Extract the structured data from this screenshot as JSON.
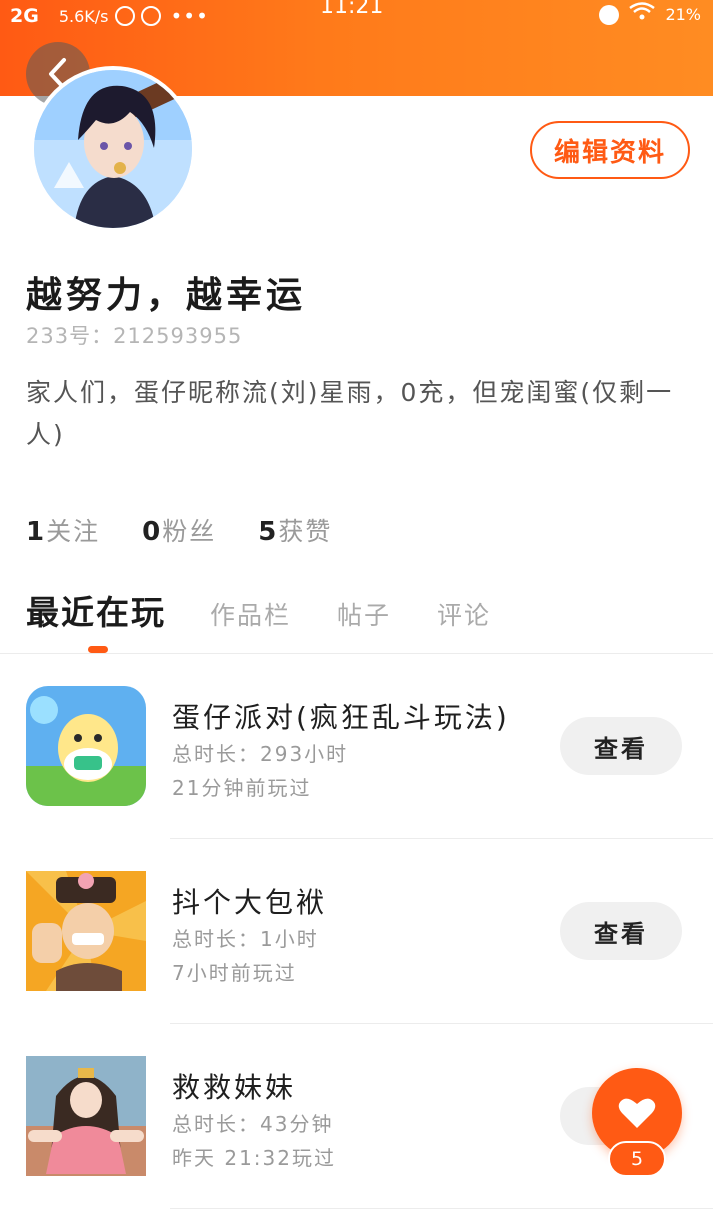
{
  "status_bar": {
    "network": "2G",
    "speed": "5.6K/s",
    "dots": "•••",
    "time": "11:21",
    "battery": "21%"
  },
  "profile": {
    "nickname": "越努力，越幸运",
    "uid": "233号：212593955",
    "bio": "家人们，蛋仔昵称流(刘)星雨，0充，但宠闺蜜(仅剩一人)",
    "edit_label": "编辑资料"
  },
  "stats": [
    {
      "num": "1",
      "label": "关注"
    },
    {
      "num": "0",
      "label": "粉丝"
    },
    {
      "num": "5",
      "label": "获赞"
    }
  ],
  "tabs": [
    {
      "label": "最近在玩",
      "active": true
    },
    {
      "label": "作品栏",
      "active": false
    },
    {
      "label": "帖子",
      "active": false
    },
    {
      "label": "评论",
      "active": false
    }
  ],
  "games": [
    {
      "title": "蛋仔派对(疯狂乱斗玩法)",
      "duration": "总时长：293小时",
      "last_played": "21分钟前玩过",
      "button": "查看",
      "icon": "eggy-party-icon"
    },
    {
      "title": "抖个大包袱",
      "duration": "总时长：1小时",
      "last_played": "7小时前玩过",
      "button": "查看",
      "icon": "doujia-icon"
    },
    {
      "title": "救救妹妹",
      "duration": "总时长：43分钟",
      "last_played": "昨天 21:32玩过",
      "button": "查看",
      "icon": "save-sister-icon"
    }
  ],
  "like": {
    "count": "5"
  },
  "colors": {
    "accent": "#ff5a14",
    "header_end": "#ff8c22"
  }
}
